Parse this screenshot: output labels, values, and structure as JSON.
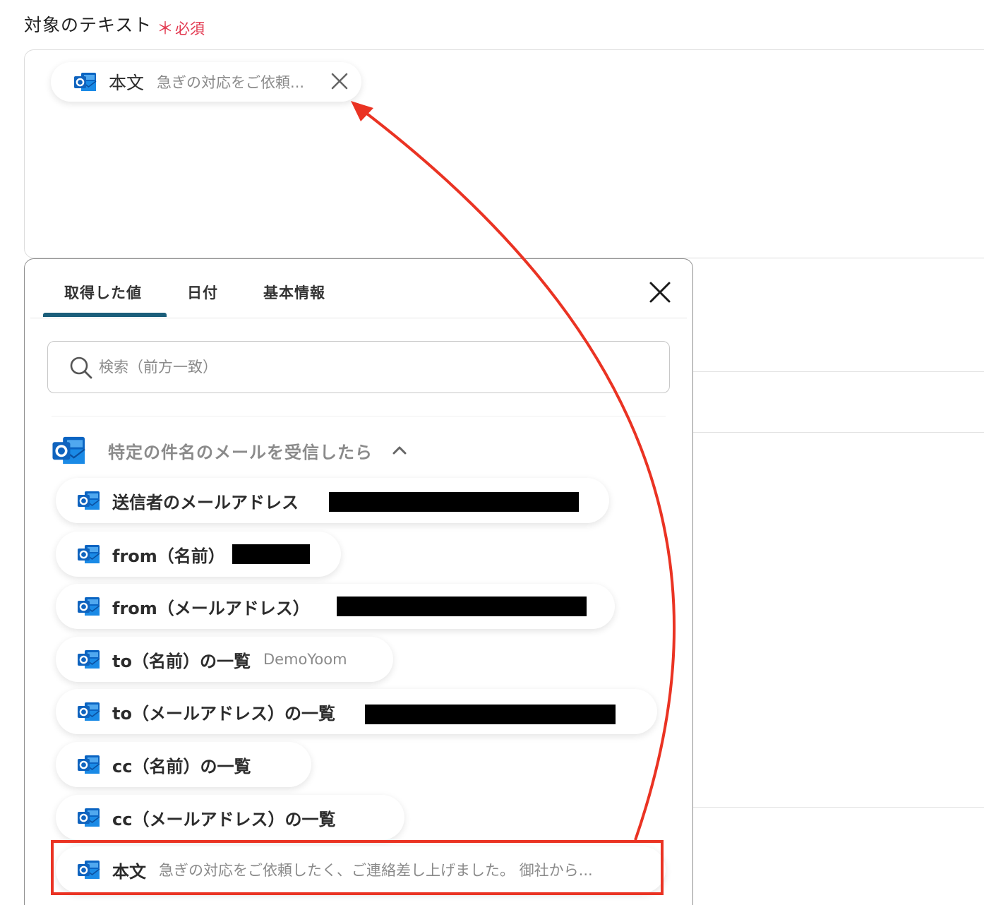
{
  "field": {
    "label": "対象のテキスト",
    "required_mark": "＊",
    "required_text": "必須"
  },
  "selected_chip": {
    "icon": "outlook-icon",
    "label": "本文",
    "value": "急ぎの対応をご依頼..."
  },
  "picker": {
    "tabs": [
      {
        "label": "取得した値",
        "active": true
      },
      {
        "label": "日付",
        "active": false
      },
      {
        "label": "基本情報",
        "active": false
      }
    ],
    "search_placeholder": "検索（前方一致）",
    "section": {
      "icon": "outlook-icon",
      "title": "特定の件名のメールを受信したら"
    },
    "items": [
      {
        "label": "送信者のメールアドレス",
        "value": ""
      },
      {
        "label": "from（名前）",
        "value": ""
      },
      {
        "label": "from（メールアドレス）",
        "value": ""
      },
      {
        "label": "to（名前）の一覧",
        "value": "DemoYoom"
      },
      {
        "label": "to（メールアドレス）の一覧",
        "value": ""
      },
      {
        "label": "cc（名前）の一覧",
        "value": ""
      },
      {
        "label": "cc（メールアドレス）の一覧",
        "value": ""
      },
      {
        "label": "本文",
        "value": "急ぎの対応をご依頼したく、ご連絡差し上げました。 御社から..."
      }
    ]
  },
  "colors": {
    "annotation": "#ea3323",
    "required": "#e2384f",
    "tab_indicator": "#1b5e7a"
  }
}
